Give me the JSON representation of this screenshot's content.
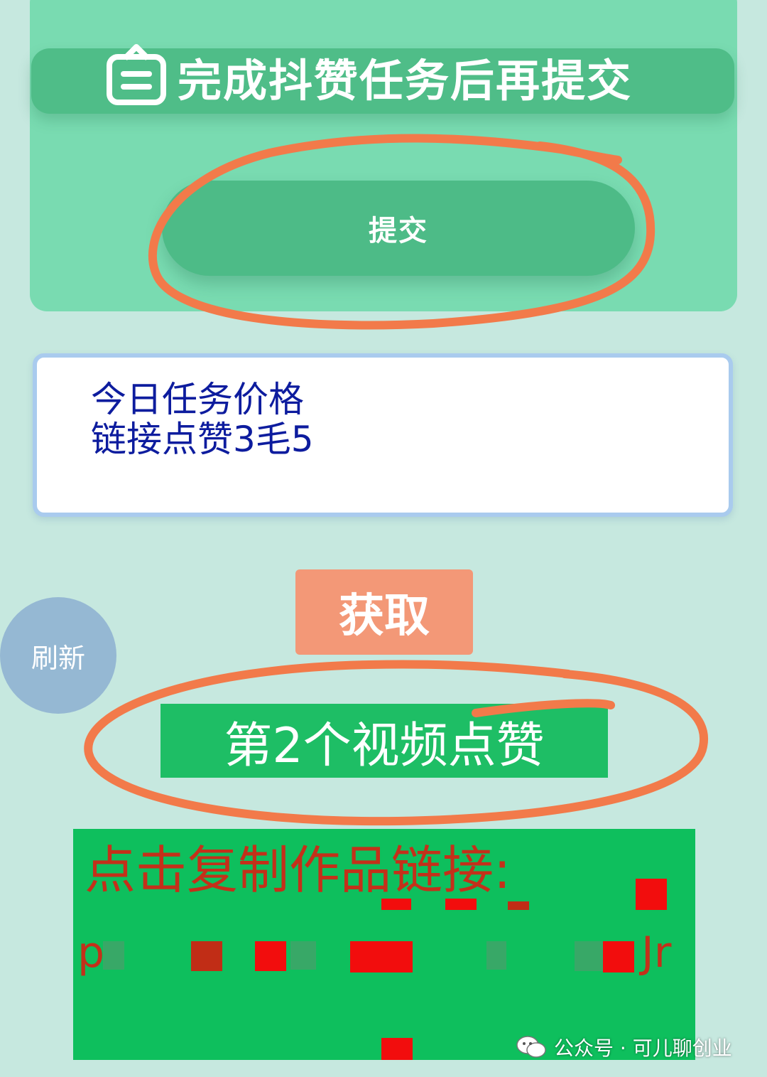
{
  "top_card": {
    "banner_text": "完成抖赞任务后再提交",
    "submit_label": "提交"
  },
  "price_card": {
    "line1": "今日任务价格",
    "line2": "链接点赞3毛5"
  },
  "actions": {
    "get_label": "获取",
    "refresh_label": "刷新"
  },
  "video_label": "第2个视频点赞",
  "link_panel": {
    "title": "点击复制作品链接:",
    "partial_left": "p",
    "partial_right": "Jr"
  },
  "watermark": {
    "text": "公众号 · 可儿聊创业",
    "icon": "wechat-icon"
  },
  "colors": {
    "background": "#c6e8df",
    "top_card": "#79dbb1",
    "banner": "#4fbd88",
    "submit_button": "#4dbb87",
    "get_button": "#f39877",
    "refresh_button": "#95b8d3",
    "video_label": "#1ebe65",
    "link_panel": "#0ebf5d",
    "link_text": "#c4301a",
    "price_text": "#0d1c9e",
    "annotation": "#f27a4a"
  }
}
